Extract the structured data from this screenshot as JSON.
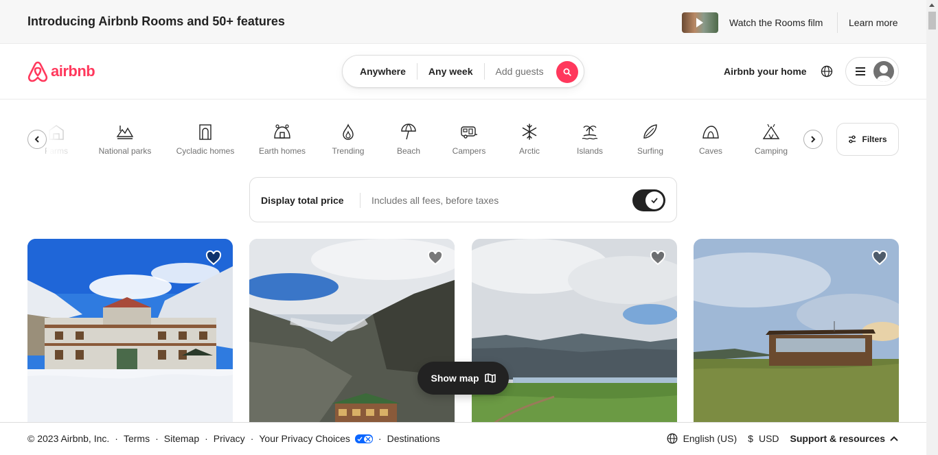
{
  "banner": {
    "title": "Introducing Airbnb Rooms and 50+ features",
    "watch_link": "Watch the Rooms film",
    "learn_more": "Learn more"
  },
  "header": {
    "logo_text": "airbnb",
    "search": {
      "where": "Anywhere",
      "when": "Any week",
      "guests_placeholder": "Add guests"
    },
    "host_link": "Airbnb your home"
  },
  "categories": {
    "items": [
      {
        "label": "Farms",
        "icon": "barn-icon"
      },
      {
        "label": "National parks",
        "icon": "mountain-icon"
      },
      {
        "label": "Cycladic homes",
        "icon": "door-icon"
      },
      {
        "label": "Earth homes",
        "icon": "earth-home-icon"
      },
      {
        "label": "Trending",
        "icon": "flame-icon"
      },
      {
        "label": "Beach",
        "icon": "umbrella-icon"
      },
      {
        "label": "Campers",
        "icon": "camper-icon"
      },
      {
        "label": "Arctic",
        "icon": "snowflake-icon"
      },
      {
        "label": "Islands",
        "icon": "palm-island-icon"
      },
      {
        "label": "Surfing",
        "icon": "surfboard-icon"
      },
      {
        "label": "Caves",
        "icon": "cave-icon"
      },
      {
        "label": "Camping",
        "icon": "tent-icon"
      }
    ],
    "filters_label": "Filters"
  },
  "price_toggle": {
    "title": "Display total price",
    "description": "Includes all fees, before taxes",
    "enabled": true
  },
  "show_map_label": "Show map",
  "footer": {
    "copyright": "© 2023 Airbnb, Inc.",
    "links": [
      "Terms",
      "Sitemap",
      "Privacy",
      "Your Privacy Choices",
      "Destinations"
    ],
    "language": "English (US)",
    "currency_symbol": "$",
    "currency": "USD",
    "support": "Support & resources"
  },
  "colors": {
    "brand": "#ff385c",
    "text": "#222222",
    "muted": "#717171"
  }
}
